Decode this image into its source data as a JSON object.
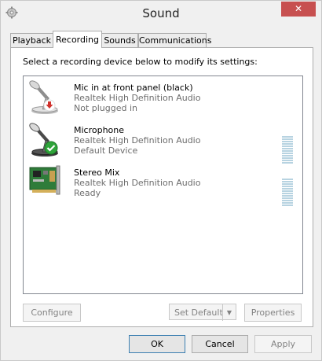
{
  "window": {
    "title": "Sound",
    "close_label": "✕"
  },
  "tabs": [
    {
      "label": "Playback",
      "active": false
    },
    {
      "label": "Recording",
      "active": true
    },
    {
      "label": "Sounds",
      "active": false
    },
    {
      "label": "Communications",
      "active": false
    }
  ],
  "panel": {
    "instruction": "Select a recording device below to modify its settings:"
  },
  "devices": [
    {
      "name": "Mic in at front panel (black)",
      "driver": "Realtek High Definition Audio",
      "status": "Not plugged in",
      "icon": "microphone-unplugged-icon"
    },
    {
      "name": "Microphone",
      "driver": "Realtek High Definition Audio",
      "status": "Default Device",
      "icon": "microphone-default-icon",
      "level": 0
    },
    {
      "name": "Stereo Mix",
      "driver": "Realtek High Definition Audio",
      "status": "Ready",
      "icon": "sound-card-icon",
      "level": 0
    }
  ],
  "buttons": {
    "configure": "Configure",
    "set_default": "Set Default",
    "properties": "Properties",
    "ok": "OK",
    "cancel": "Cancel",
    "apply": "Apply"
  },
  "colors": {
    "close": "#c75050",
    "meter": "#b7d3e1",
    "check": "#2fa43a",
    "unplugged": "#d0322d"
  }
}
